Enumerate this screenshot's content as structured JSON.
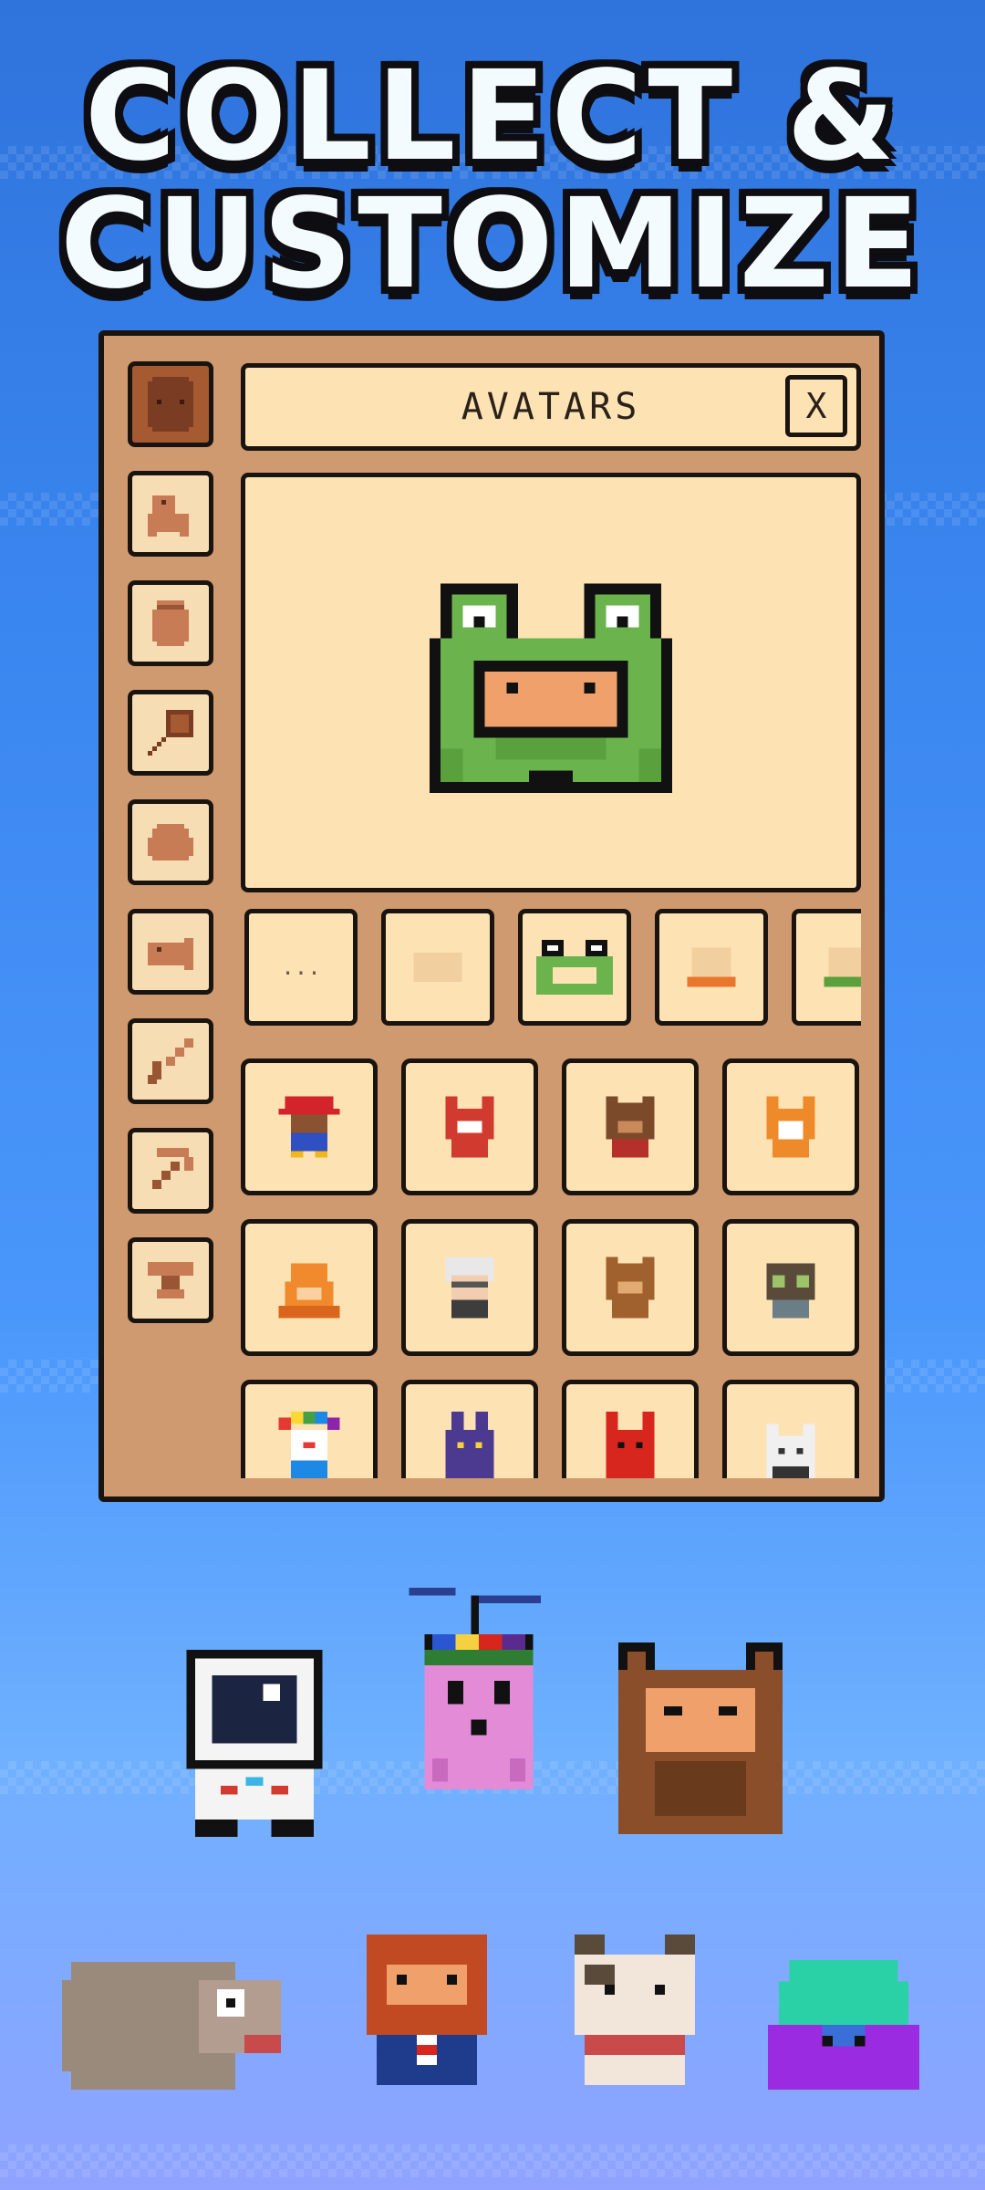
{
  "headline": {
    "line1": "COLLECT &",
    "line2": "CUSTOMIZE"
  },
  "panel": {
    "title": "AVATARS",
    "close_label": "X",
    "swatch_dots": "..."
  },
  "categories": [
    "avatar-head-icon",
    "dog-icon",
    "pot-icon",
    "frying-pan-icon",
    "stone-icon",
    "fish-icon",
    "sword-icon",
    "pickaxe-icon",
    "anvil-icon"
  ],
  "avatar_grid": [
    "red-hat-kid",
    "red-fox",
    "brown-bear",
    "orange-cat",
    "orange-crab",
    "white-haired-elder",
    "brown-bear-cub",
    "goggles-frog",
    "rainbow-clown",
    "purple-bunny",
    "red-devil",
    "white-cat"
  ],
  "colors": {
    "panel": "#cf9a6f",
    "card": "#fde2b3",
    "outline": "#1a1410",
    "frog": "#6ab34d",
    "face": "#f0a06a"
  }
}
